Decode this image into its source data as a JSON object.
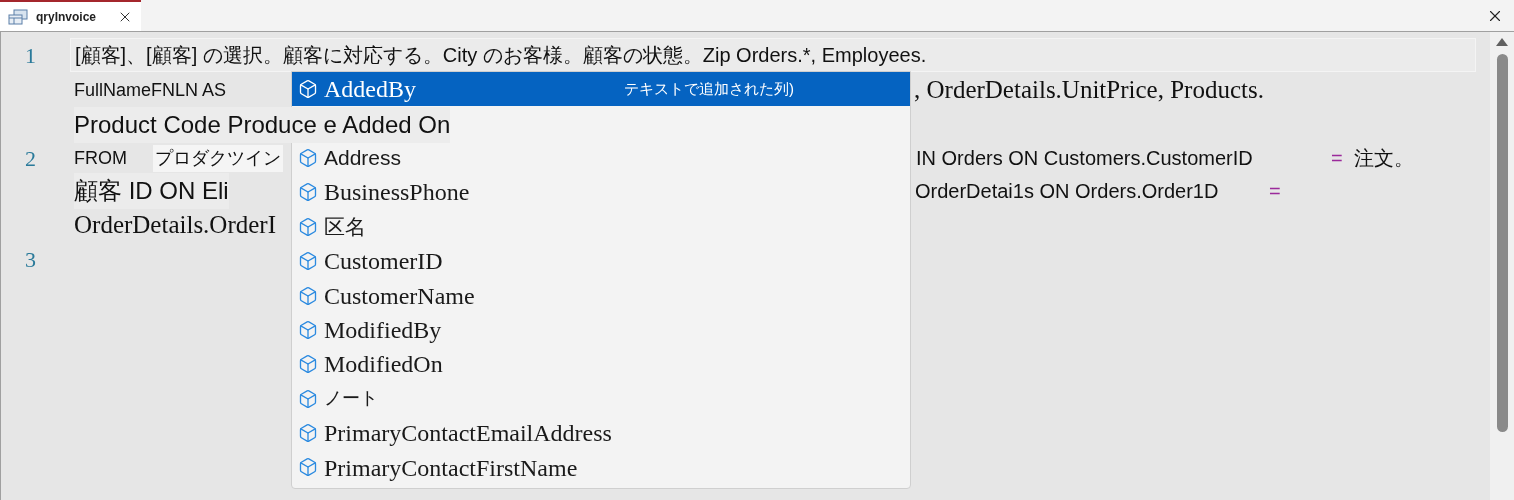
{
  "tab": {
    "title": "qryInvoice",
    "selected": true
  },
  "editor": {
    "rows": [
      {
        "number": "1",
        "current": true,
        "segments": [
          {
            "text": "[顧客]、[顧客] の選択。顧客に対応する。City のお客様。顧客の状態。Zip Orders.*, Employees.",
            "kind": "sans"
          }
        ]
      },
      {
        "segments": [
          {
            "text": "FullNameFNLN AS",
            "kind": "small"
          },
          {
            "text": ", OrderDetails.UnitPrice, Products.",
            "kind": "serif"
          }
        ]
      },
      {
        "segments": [
          {
            "text": "Product Code Produce e Added On",
            "kind": "large"
          }
        ]
      },
      {
        "number": "2",
        "segments": [
          {
            "text": "FROM",
            "kind": "small"
          },
          {
            "text": "プロダクツイン",
            "kind": "boxed"
          },
          {
            "text": "IN Orders ON Customers.CustomerID",
            "kind": "sans"
          },
          {
            "text": "=",
            "kind": "operator"
          },
          {
            "text": "注文。",
            "kind": "sans"
          }
        ]
      },
      {
        "segments": [
          {
            "text": "顧客 ID ON Eli",
            "kind": "large"
          },
          {
            "text": "OrderDetai1s ON Orders.Order1D",
            "kind": "sans"
          },
          {
            "text": "=",
            "kind": "operator"
          }
        ]
      },
      {
        "segments": [
          {
            "text": "OrderDetails.OrderI",
            "kind": "serif"
          }
        ]
      },
      {
        "number": "3",
        "segments": []
      }
    ]
  },
  "completion": {
    "items": [
      {
        "label": "AddedBy",
        "kind": "serif",
        "selected": true,
        "hint": "テキストで追加された列)"
      },
      {
        "label": "Address",
        "kind": "sans",
        "selected": false
      },
      {
        "label": "BusinessPhone",
        "kind": "serif",
        "selected": false
      },
      {
        "label": "区名",
        "kind": "sans",
        "selected": false
      },
      {
        "label": "CustomerID",
        "kind": "serif",
        "selected": false
      },
      {
        "label": "CustomerName",
        "kind": "serif",
        "selected": false
      },
      {
        "label": "ModifiedBy",
        "kind": "serif",
        "selected": false
      },
      {
        "label": "ModifiedOn",
        "kind": "serif",
        "selected": false
      },
      {
        "label": "ノート",
        "kind": "thin",
        "selected": false
      },
      {
        "label": "PrimaryContactEmailAddress",
        "kind": "serif",
        "selected": false
      },
      {
        "label": "PrimaryContactFirstName",
        "kind": "serif",
        "selected": false
      }
    ]
  }
}
